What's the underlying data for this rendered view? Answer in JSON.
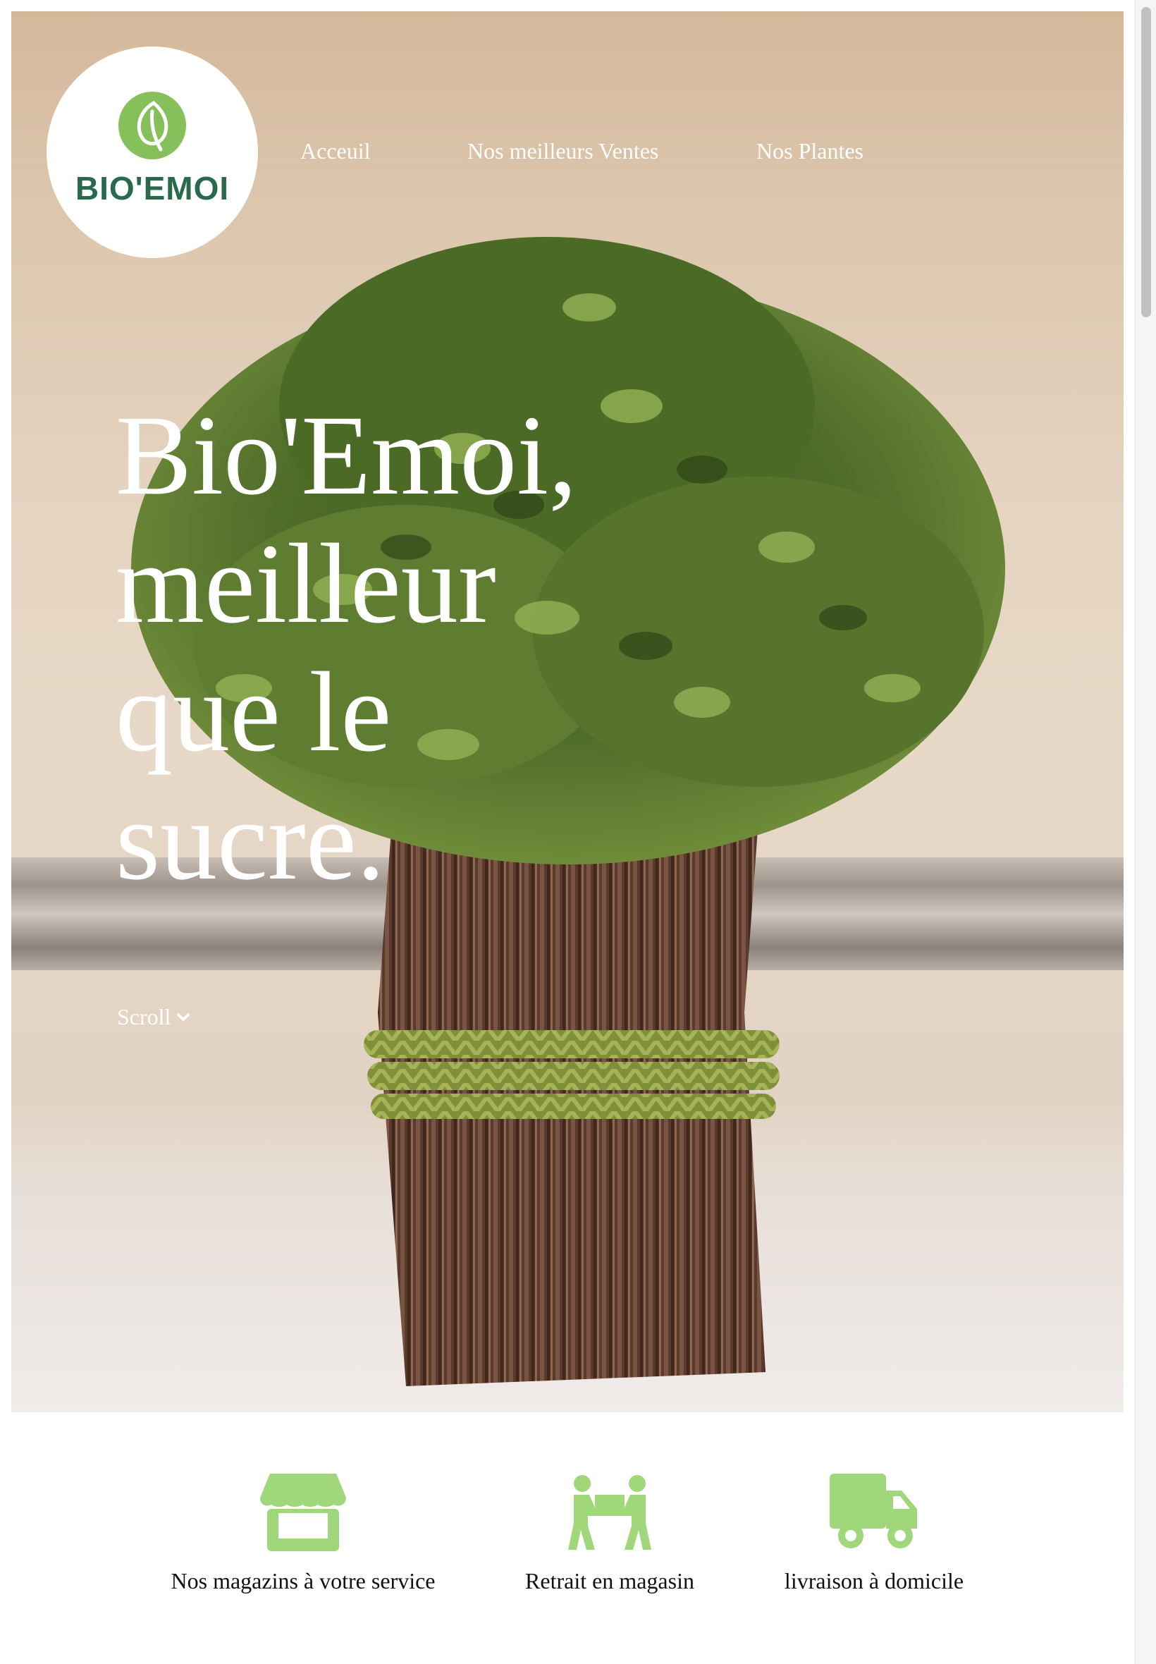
{
  "brand": {
    "logo_text": "BIO'EMOI",
    "logo_color": "#2a6a4c",
    "leaf_color": "#86c05a"
  },
  "nav": {
    "items": [
      {
        "label": "Acceuil"
      },
      {
        "label": "Nos meilleurs Ventes"
      },
      {
        "label": "Nos Plantes"
      }
    ]
  },
  "hero": {
    "headline_lines": [
      "Bio'Emoi,",
      "meilleur",
      "que le",
      "sucre."
    ],
    "scroll_label": "Scroll",
    "scroll_icon": "chevron-down-icon"
  },
  "services": {
    "accent_color": "#a0d77a",
    "items": [
      {
        "label": "Nos magazins à votre service",
        "icon": "store-icon"
      },
      {
        "label": "Retrait en magasin",
        "icon": "people-carry-icon"
      },
      {
        "label": "livraison à domicile",
        "icon": "truck-icon"
      }
    ]
  }
}
